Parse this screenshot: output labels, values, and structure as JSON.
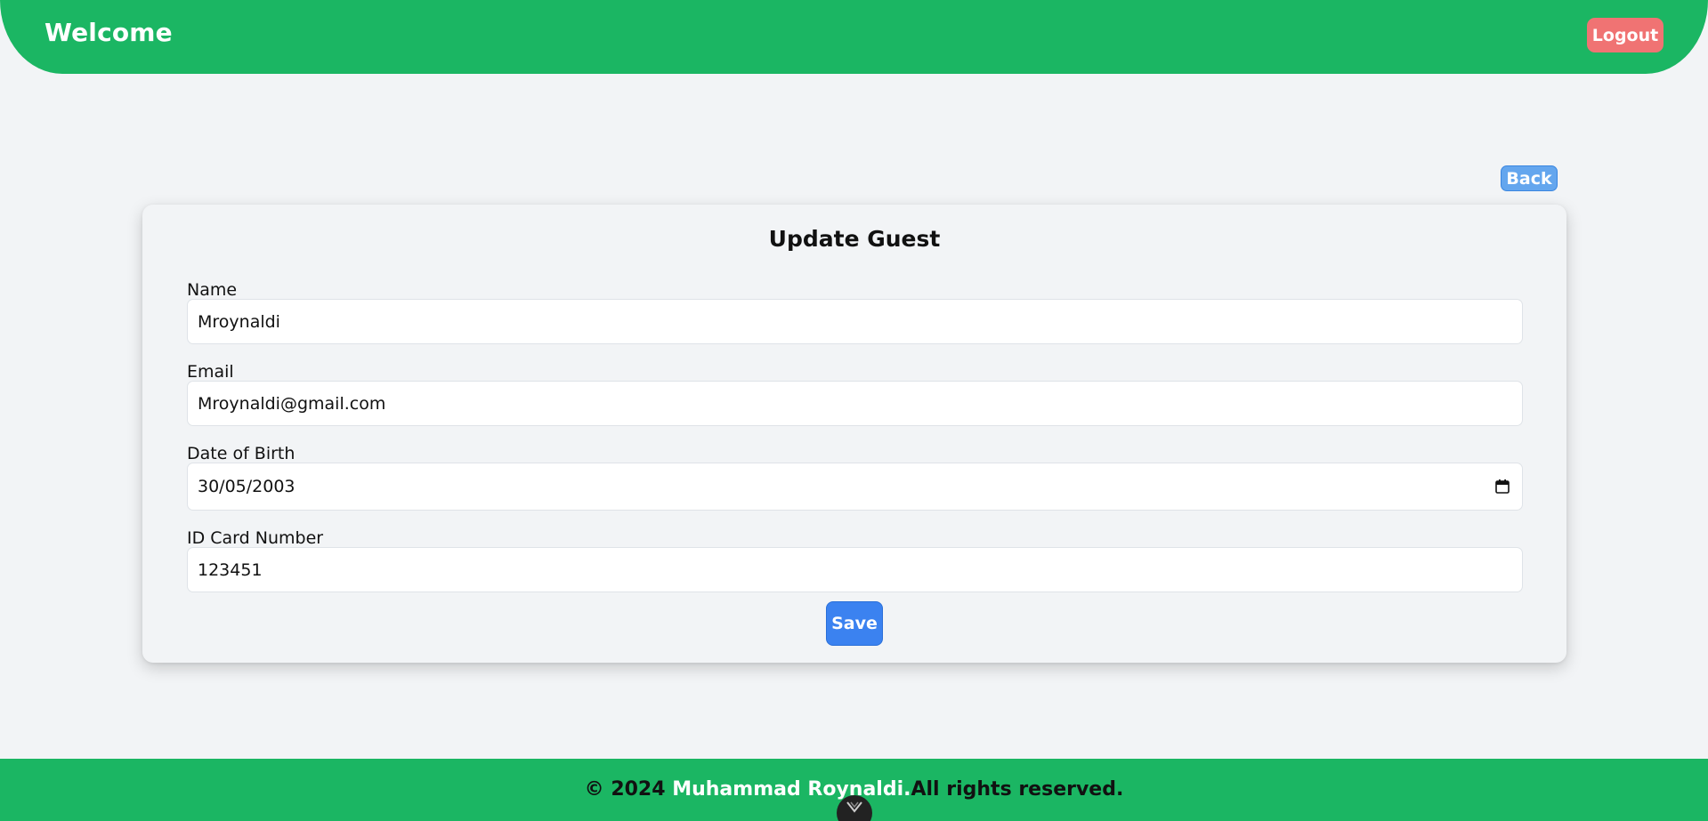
{
  "header": {
    "title": "Welcome",
    "logout_label": "Logout"
  },
  "back_label": "Back",
  "form": {
    "title": "Update Guest",
    "fields": [
      {
        "label": "Name",
        "value": "Mroynaldi"
      },
      {
        "label": "Email",
        "value": "Mroynaldi@gmail.com"
      },
      {
        "label": "Date of Birth",
        "value": "30/05/2003"
      },
      {
        "label": "ID Card Number",
        "value": "123451"
      }
    ],
    "save_label": "Save"
  },
  "footer": {
    "prefix": "© 2024 ",
    "author": "Muhammad Roynaldi.",
    "suffix": "All rights reserved."
  },
  "icons": {
    "calendar": "calendar-icon",
    "devtools": "vue-devtools-icon"
  },
  "colors": {
    "brand_green": "#1bb663",
    "logout_red": "#f07373",
    "back_blue": "#64a6ee",
    "save_blue": "#3b82f0",
    "page_bg": "#f2f4f6"
  }
}
